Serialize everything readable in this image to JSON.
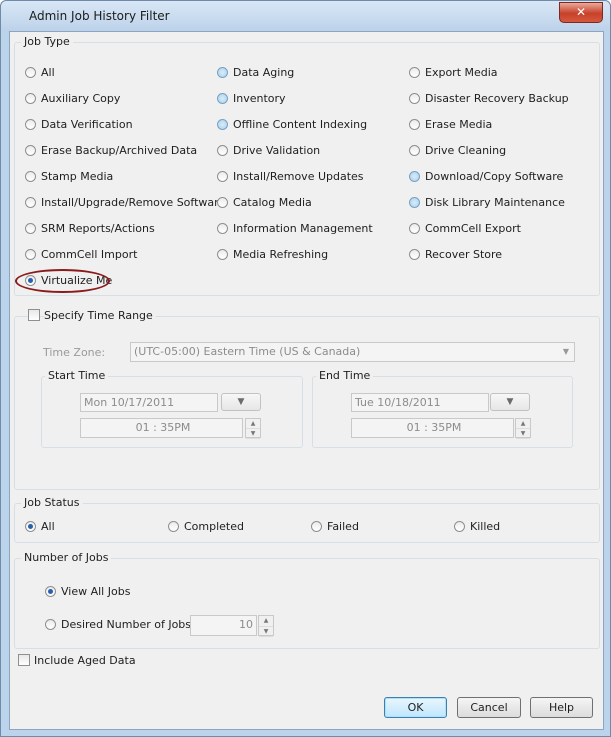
{
  "window": {
    "title": "Admin Job History Filter",
    "close_label": "✕"
  },
  "job_type": {
    "label": "Job Type",
    "options": [
      {
        "label": "All",
        "selected": false,
        "blue": false
      },
      {
        "label": "Data Aging",
        "selected": false,
        "blue": true
      },
      {
        "label": "Export Media",
        "selected": false,
        "blue": false
      },
      {
        "label": "Auxiliary Copy",
        "selected": false,
        "blue": false
      },
      {
        "label": "Inventory",
        "selected": false,
        "blue": true
      },
      {
        "label": "Disaster Recovery Backup",
        "selected": false,
        "blue": false
      },
      {
        "label": "Data Verification",
        "selected": false,
        "blue": false
      },
      {
        "label": "Offline Content Indexing",
        "selected": false,
        "blue": true
      },
      {
        "label": "Erase Media",
        "selected": false,
        "blue": false
      },
      {
        "label": "Erase Backup/Archived Data",
        "selected": false,
        "blue": false
      },
      {
        "label": "Drive Validation",
        "selected": false,
        "blue": false
      },
      {
        "label": "Drive Cleaning",
        "selected": false,
        "blue": false
      },
      {
        "label": "Stamp Media",
        "selected": false,
        "blue": false
      },
      {
        "label": "Install/Remove Updates",
        "selected": false,
        "blue": false
      },
      {
        "label": "Download/Copy Software",
        "selected": false,
        "blue": true
      },
      {
        "label": "Install/Upgrade/Remove Software",
        "selected": false,
        "blue": false
      },
      {
        "label": "Catalog Media",
        "selected": false,
        "blue": false
      },
      {
        "label": "Disk Library Maintenance",
        "selected": false,
        "blue": true
      },
      {
        "label": "SRM Reports/Actions",
        "selected": false,
        "blue": false
      },
      {
        "label": "Information Management",
        "selected": false,
        "blue": false
      },
      {
        "label": "CommCell Export",
        "selected": false,
        "blue": false
      },
      {
        "label": "CommCell Import",
        "selected": false,
        "blue": false
      },
      {
        "label": "Media Refreshing",
        "selected": false,
        "blue": false
      },
      {
        "label": "Recover Store",
        "selected": false,
        "blue": false
      },
      {
        "label": "Virtualize Me",
        "selected": true,
        "blue": false
      }
    ]
  },
  "time_range": {
    "checkbox_label": "Specify Time Range",
    "time_zone_label": "Time Zone:",
    "time_zone_value": "(UTC-05:00) Eastern Time (US & Canada)",
    "start": {
      "label": "Start Time",
      "date": "Mon 10/17/2011",
      "time": "01 : 35PM"
    },
    "end": {
      "label": "End Time",
      "date": "Tue 10/18/2011",
      "time": "01 : 35PM"
    }
  },
  "job_status": {
    "label": "Job Status",
    "options": [
      {
        "label": "All",
        "selected": true
      },
      {
        "label": "Completed",
        "selected": false
      },
      {
        "label": "Failed",
        "selected": false
      },
      {
        "label": "Killed",
        "selected": false
      }
    ]
  },
  "number_of_jobs": {
    "label": "Number of Jobs",
    "view_all_label": "View All Jobs",
    "view_all_selected": true,
    "desired_label": "Desired Number of Jobs",
    "desired_value": "10"
  },
  "include_aged_label": "Include Aged Data",
  "buttons": {
    "ok": "OK",
    "cancel": "Cancel",
    "help": "Help"
  },
  "colors": {
    "selected_dot": "#2a5fb0",
    "highlight_ellipse": "#8b1a1a",
    "title_bar": "#bcd2ea"
  }
}
